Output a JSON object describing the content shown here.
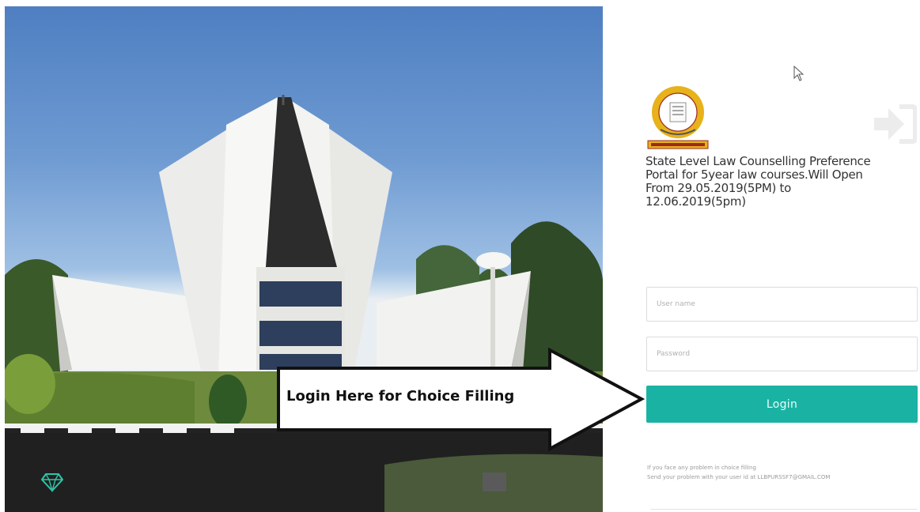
{
  "notice": {
    "text": "State Level Law Counselling Preference Portal for 5year law courses.Will Open From 29.05.2019(5PM) to 12.06.2019(5pm)"
  },
  "login_form": {
    "username_placeholder": "User name",
    "password_placeholder": "Password",
    "login_label": "Login"
  },
  "help": {
    "line1": "If you face any problem in choice filling",
    "line2": "Send your problem with your user id at LLBPURSSF7@GMAIL.COM"
  },
  "callout": {
    "text": "Login Here for Choice Filling"
  },
  "colors": {
    "accent": "#1ab3a3",
    "logo_ring": "#e7b21a",
    "gem_icon": "#2ec4a8"
  },
  "icons": {
    "exit": "sign-in-icon",
    "gem": "gem-icon",
    "logo": "university-logo"
  }
}
